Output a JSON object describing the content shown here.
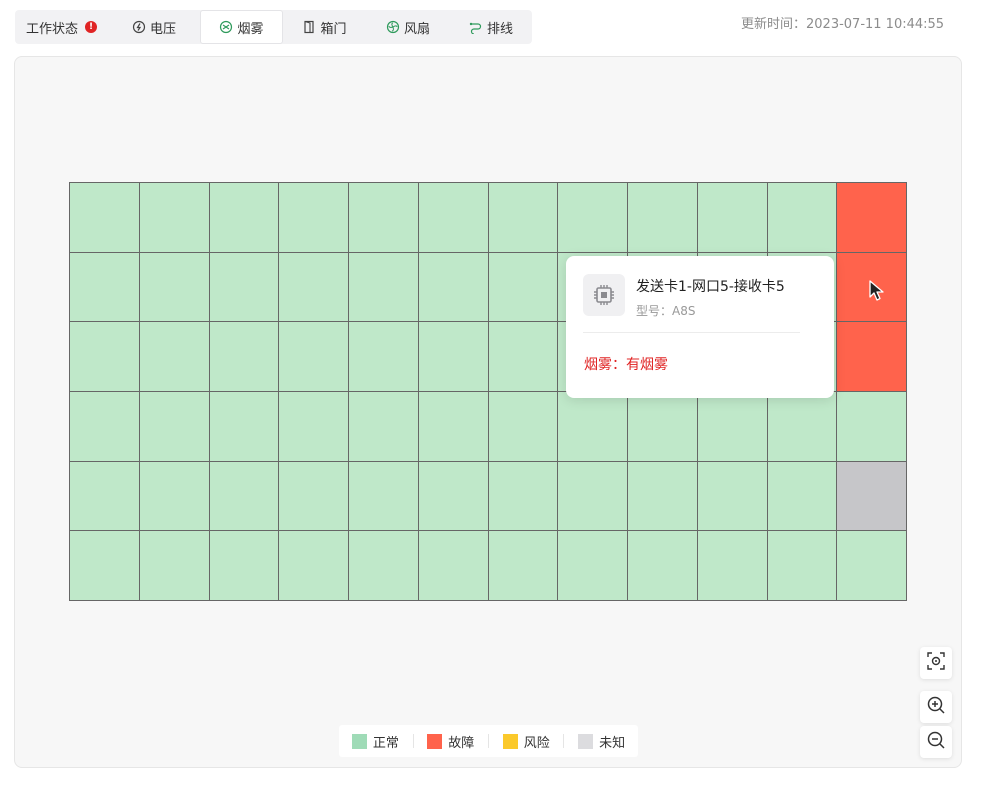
{
  "tabs": [
    {
      "label": "工作状态",
      "icon": "alert-icon",
      "active": false
    },
    {
      "label": "电压",
      "icon": "voltage-icon",
      "active": false
    },
    {
      "label": "烟雾",
      "icon": "smoke-icon",
      "active": true
    },
    {
      "label": "箱门",
      "icon": "door-icon",
      "active": false
    },
    {
      "label": "风扇",
      "icon": "fan-icon",
      "active": false
    },
    {
      "label": "排线",
      "icon": "cable-icon",
      "active": false
    }
  ],
  "alert_badge": "!",
  "update_time": "更新时间：2023-07-11 10:44:55",
  "colors": {
    "normal": "#bfe8c9",
    "fault": "#ff634c",
    "risk": "#fbc92b",
    "unknown": "#c6c6c9",
    "alert": "#e02424"
  },
  "grid": {
    "rows": 6,
    "cols": 12,
    "cells": [
      [
        "normal",
        "normal",
        "normal",
        "normal",
        "normal",
        "normal",
        "normal",
        "normal",
        "normal",
        "normal",
        "normal",
        "fault"
      ],
      [
        "normal",
        "normal",
        "normal",
        "normal",
        "normal",
        "normal",
        "normal",
        "normal",
        "normal",
        "normal",
        "normal",
        "fault"
      ],
      [
        "normal",
        "normal",
        "normal",
        "normal",
        "normal",
        "normal",
        "normal",
        "normal",
        "normal",
        "normal",
        "normal",
        "fault"
      ],
      [
        "normal",
        "normal",
        "normal",
        "normal",
        "normal",
        "normal",
        "normal",
        "normal",
        "normal",
        "normal",
        "normal",
        "normal"
      ],
      [
        "normal",
        "normal",
        "normal",
        "normal",
        "normal",
        "normal",
        "normal",
        "normal",
        "normal",
        "normal",
        "normal",
        "unknown"
      ],
      [
        "normal",
        "normal",
        "normal",
        "normal",
        "normal",
        "normal",
        "normal",
        "normal",
        "normal",
        "normal",
        "normal",
        "normal"
      ]
    ]
  },
  "tooltip": {
    "title": "发送卡1-网口5-接收卡5",
    "model": "型号：A8S",
    "status": "烟雾：有烟雾"
  },
  "legend": [
    {
      "label": "正常",
      "color": "#9fdbb7"
    },
    {
      "label": "故障",
      "color": "#ff634c"
    },
    {
      "label": "风险",
      "color": "#fbc92b"
    },
    {
      "label": "未知",
      "color": "#dcdcdf"
    }
  ]
}
